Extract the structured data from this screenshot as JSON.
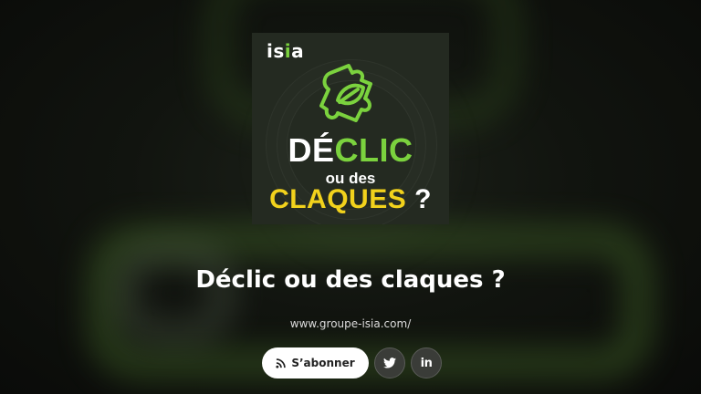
{
  "cover": {
    "logo_prefix": "is",
    "logo_dot": "i",
    "logo_suffix": "a",
    "line1_white": "DÉ",
    "line1_green": "CLIC",
    "line2": "ou des",
    "line3_yellow": "CLAQUES",
    "line3_mark": "?"
  },
  "podcast": {
    "title": "Déclic ou des claques ?",
    "website": "www.groupe-isia.com/"
  },
  "actions": {
    "subscribe_label": "S’abonner",
    "linkedin_label": "in"
  },
  "colors": {
    "accent_green": "#7bd23e",
    "accent_yellow": "#f2d21c",
    "background": "#0d0f0c"
  },
  "icons": {
    "subscribe": "rss-icon",
    "twitter": "twitter-icon",
    "linkedin": "linkedin-icon",
    "cover": "puzzle-leaf-icon"
  }
}
